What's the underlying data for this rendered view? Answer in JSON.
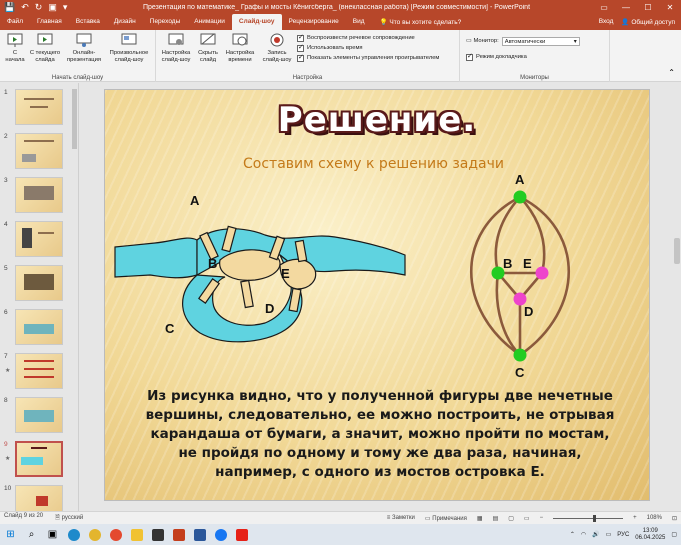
{
  "window": {
    "title": "Презентация по математике_ Графы и мосты Кёнигсберга_ (внеклассная работа) [Режим совместимости] - PowerPoint",
    "controls": [
      "—",
      "☐",
      "✕"
    ]
  },
  "tabs": [
    {
      "label": "Файл"
    },
    {
      "label": "Главная"
    },
    {
      "label": "Вставка"
    },
    {
      "label": "Дизайн"
    },
    {
      "label": "Переходы"
    },
    {
      "label": "Анимации"
    },
    {
      "label": "Слайд-шоу",
      "active": true
    },
    {
      "label": "Рецензирование"
    },
    {
      "label": "Вид"
    }
  ],
  "tell_me": "Что вы хотите сделать?",
  "signin": "Вход",
  "share": "Общий доступ",
  "ribbon": {
    "start_group": {
      "label": "Начать слайд-шоу",
      "buttons": [
        "С начала",
        "С текущего слайда",
        "Онлайн-презентация",
        "Произвольное слайд-шоу"
      ]
    },
    "setup_group": {
      "label": "Настройка",
      "buttons": [
        "Настройка слайд-шоу",
        "Скрыть слайд",
        "Настройка времени",
        "Запись слайд-шоу"
      ],
      "checks": [
        "Воспроизвести речевое сопровождение",
        "Использовать время",
        "Показать элементы управления проигрывателем"
      ]
    },
    "monitors_group": {
      "label": "Мониторы",
      "monitor_label": "Монитор:",
      "monitor_value": "Автоматически",
      "presenter_view": "Режим докладчика"
    }
  },
  "thumbnails": [
    {
      "num": "1"
    },
    {
      "num": "2"
    },
    {
      "num": "3"
    },
    {
      "num": "4"
    },
    {
      "num": "5"
    },
    {
      "num": "6"
    },
    {
      "num": "7",
      "star": "★"
    },
    {
      "num": "8"
    },
    {
      "num": "9",
      "star": "★",
      "selected": true
    },
    {
      "num": "10"
    }
  ],
  "slide": {
    "title": "Решение.",
    "subtitle": "Составим схему к решению задачи",
    "map_labels": {
      "a": "A",
      "b": "B",
      "c": "C",
      "d": "D",
      "e": "E"
    },
    "graph_labels": {
      "a": "A",
      "b": "B",
      "c": "C",
      "d": "D",
      "e": "E"
    },
    "body": "Из рисунка видно, что у полученной фигуры две нечетные вершины, следовательно, ее можно построить, не отрывая карандаша от бумаги, а значит, можно пройти по мостам, не пройдя по одному и тому же два раза, начиная, например, с одного из мостов островка Е."
  },
  "status": {
    "slide_info": "Слайд 9 из 20",
    "language": "русский",
    "notes": "Заметки",
    "comments": "Примечания",
    "zoom": "108%"
  },
  "taskbar": {
    "lang": "РУС",
    "time": "13:09",
    "date": "06.04.2025"
  },
  "colors": {
    "accent": "#b7472a",
    "node_green": "#22cc22",
    "node_pink": "#ee44cc",
    "edge": "#8b5a3c",
    "water": "#5fd3e0"
  }
}
